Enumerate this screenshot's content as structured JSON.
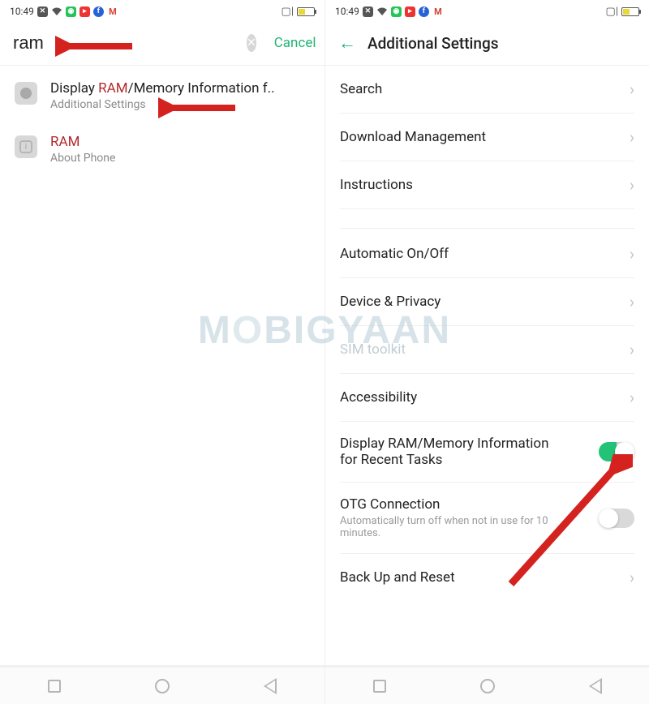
{
  "status": {
    "time": "10:49",
    "vibrate_glyph": "⦿"
  },
  "left": {
    "search_value": "ram",
    "cancel_label": "Cancel",
    "results": [
      {
        "title_pre": "Display ",
        "title_hl": "RAM",
        "title_post": "/Memory Information f..",
        "subtitle": "Additional Settings"
      },
      {
        "title_pre": "",
        "title_hl": "RAM",
        "title_post": "",
        "subtitle": "About Phone"
      }
    ]
  },
  "right": {
    "title": "Additional Settings",
    "rows": {
      "search": "Search",
      "download": "Download Management",
      "instructions": "Instructions",
      "auto_onoff": "Automatic On/Off",
      "device_privacy": "Device & Privacy",
      "sim_toolkit": "SIM toolkit",
      "accessibility": "Accessibility",
      "display_ram": "Display RAM/Memory Information for Recent Tasks",
      "otg_title": "OTG Connection",
      "otg_sub": "Automatically turn off when not in use for 10 minutes.",
      "backup": "Back Up and Reset"
    }
  },
  "watermark": "MOBIGYAAN"
}
